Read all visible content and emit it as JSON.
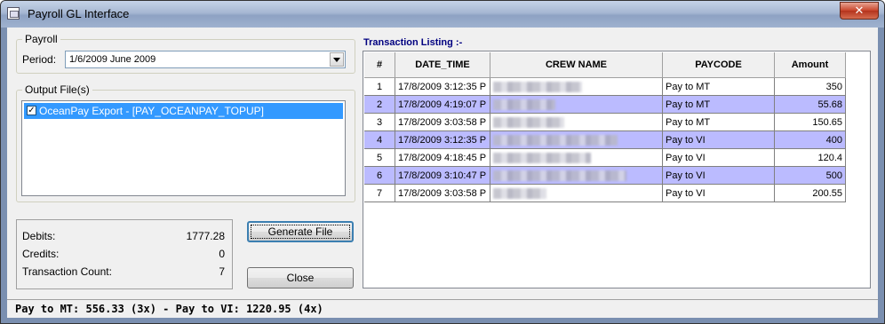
{
  "window": {
    "title": "Payroll GL Interface"
  },
  "payroll": {
    "group_label": "Payroll",
    "period_label": "Period:",
    "period_value": "1/6/2009  June 2009"
  },
  "output": {
    "group_label": "Output File(s)",
    "items": [
      {
        "label": "OceanPay Export - [PAY_OCEANPAY_TOPUP]",
        "checked": true
      }
    ]
  },
  "totals": {
    "debits_label": "Debits:",
    "debits_value": "1777.28",
    "credits_label": "Credits:",
    "credits_value": "0",
    "count_label": "Transaction Count:",
    "count_value": "7"
  },
  "buttons": {
    "generate": "Generate File",
    "close": "Close"
  },
  "listing": {
    "title": "Transaction Listing :-",
    "columns": [
      "#",
      "DATE_TIME",
      "CREW NAME",
      "PAYCODE",
      "Amount"
    ],
    "rows": [
      {
        "num": "1",
        "date": "17/8/2009 3:12:35 P",
        "paycode": "Pay to MT",
        "amount": "350"
      },
      {
        "num": "2",
        "date": "17/8/2009 4:19:07 P",
        "paycode": "Pay to MT",
        "amount": "55.68"
      },
      {
        "num": "3",
        "date": "17/8/2009 3:03:58 P",
        "paycode": "Pay to MT",
        "amount": "150.65"
      },
      {
        "num": "4",
        "date": "17/8/2009 3:12:35 P",
        "paycode": "Pay to VI",
        "amount": "400"
      },
      {
        "num": "5",
        "date": "17/8/2009 4:18:45 P",
        "paycode": "Pay to VI",
        "amount": "120.4"
      },
      {
        "num": "6",
        "date": "17/8/2009 3:10:47 P",
        "paycode": "Pay to VI",
        "amount": "500"
      },
      {
        "num": "7",
        "date": "17/8/2009 3:03:58 P",
        "paycode": "Pay to VI",
        "amount": "200.55"
      }
    ]
  },
  "status": {
    "text": "Pay to MT: 556.33 (3x) - Pay to VI: 1220.95 (4x)"
  },
  "colors": {
    "highlight_row": "#bbbbff",
    "selection": "#3399ff",
    "title_blue": "#000080"
  }
}
